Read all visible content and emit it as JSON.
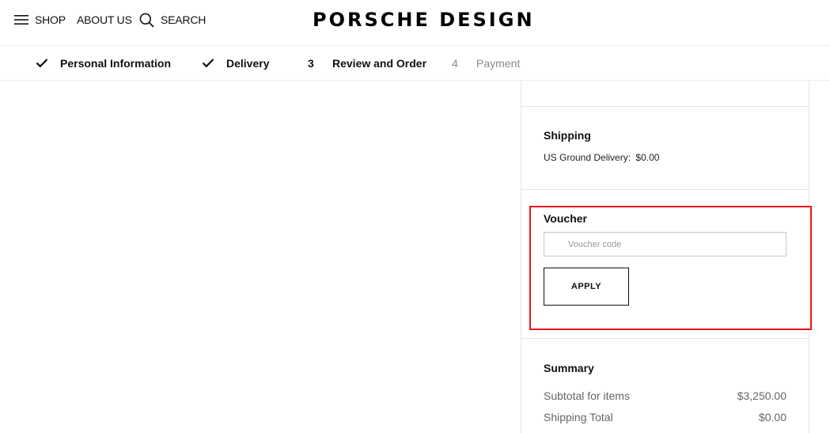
{
  "header": {
    "nav": {
      "shop": "SHOP",
      "about": "ABOUT US",
      "search": "SEARCH"
    },
    "logo": "PORSCHE DESIGN"
  },
  "steps": [
    {
      "marker": "",
      "label": "Personal Information",
      "state": "done"
    },
    {
      "marker": "",
      "label": "Delivery",
      "state": "done"
    },
    {
      "marker": "3",
      "label": "Review and Order",
      "state": "active"
    },
    {
      "marker": "4",
      "label": "Payment",
      "state": "upcoming"
    }
  ],
  "shipping": {
    "title": "Shipping",
    "method": "US Ground Delivery:",
    "price": "$0.00"
  },
  "voucher": {
    "title": "Voucher",
    "placeholder": "Voucher code",
    "value": "",
    "apply_label": "APPLY"
  },
  "summary": {
    "title": "Summary",
    "rows": [
      {
        "label": "Subtotal for items",
        "value": "$3,250.00"
      },
      {
        "label": "Shipping Total",
        "value": "$0.00"
      }
    ]
  },
  "colors": {
    "highlight": "#e8141b",
    "text": "#111111",
    "muted": "#8a8a8a"
  }
}
